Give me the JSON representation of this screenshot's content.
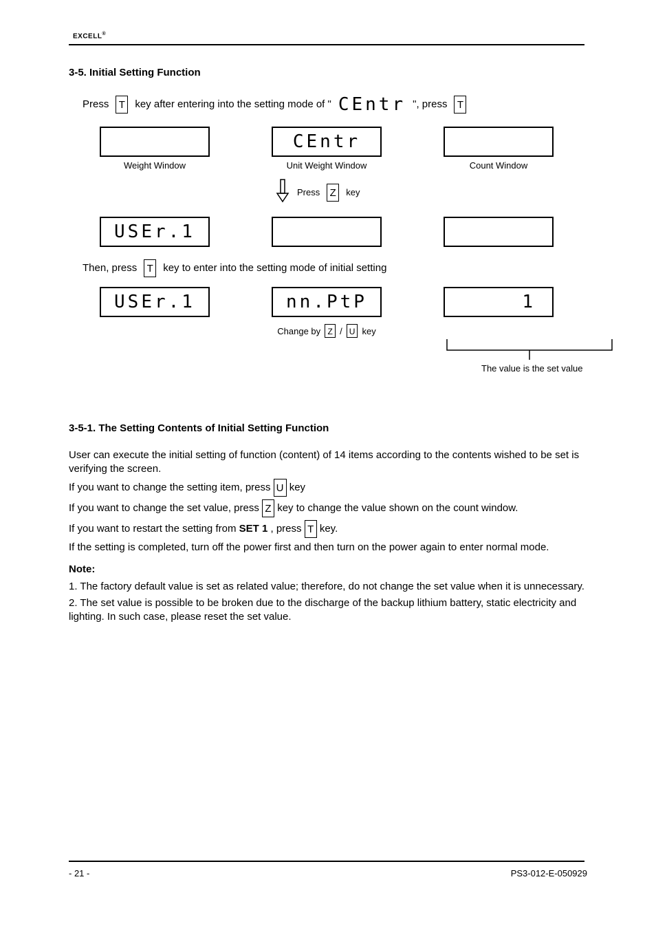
{
  "header": {
    "logo_label": "EXCELL",
    "logo_reg": "®"
  },
  "section3_5": {
    "heading": "3-5. Initial Setting Function",
    "line1_pre": "Press ",
    "line1_key": "T",
    "line1_mid": " key after entering into the setting mode of \"",
    "line1_seg": "CEntr",
    "line1_post": "\", press ",
    "line1_key2": "T",
    "row1": {
      "left_caption": "Weight Window",
      "mid_seg": "CEntr",
      "mid_caption": "Unit Weight Window",
      "right_caption": "Count Window"
    },
    "arrow_hint_left": "Press ",
    "arrow_key_z": "Z",
    "arrow_hint_right": " key",
    "row2": {
      "left_seg": "USEr.1",
      "mid_caption": "",
      "right_caption": ""
    },
    "line2_pre": "Then, press ",
    "line2_key": "T",
    "line2_post": " key to enter into the setting mode of initial setting",
    "row3": {
      "left_seg": "USEr.1",
      "mid_seg": "nn.PtP",
      "right_seg": "1"
    },
    "mid_note_pre": "Change by ",
    "mid_note_key1": "Z",
    "mid_note_sep": "/",
    "mid_note_key2": "U",
    "mid_note_post": " key",
    "bracket_note": "The value is the set value"
  },
  "section3_5_1": {
    "heading": "3-5-1. The Setting Contents of Initial Setting Function",
    "p1": "User can execute the initial setting of function (content) of 14 items according to the contents wished to be set is verifying the screen.",
    "p2_pre": "If you want to change the setting item, press ",
    "p2_key": "U",
    "p2_post": " key",
    "p3_pre": "If you want to change the set value, press ",
    "p3_key": "Z",
    "p3_post": " key to change the value shown on the count window.",
    "p4_pre": "If you want to restart the setting from ",
    "p4_setbox": "SET 1",
    "p4_post": " , press ",
    "p4_key": "T",
    "p4_tail": " key.",
    "p5": "If the setting is completed, turn off the power first and then turn on the power again to enter normal mode.",
    "note_heading": "Note:",
    "note1": "1. The factory default value is set as related value; therefore, do not change the set value when it is unnecessary.",
    "note2": "2. The set value is possible to be broken due to the discharge of the backup lithium battery, static electricity and lighting. In such case, please reset the set value."
  },
  "footer": {
    "left": "- 21 -",
    "right": "PS3-012-E-050929"
  }
}
